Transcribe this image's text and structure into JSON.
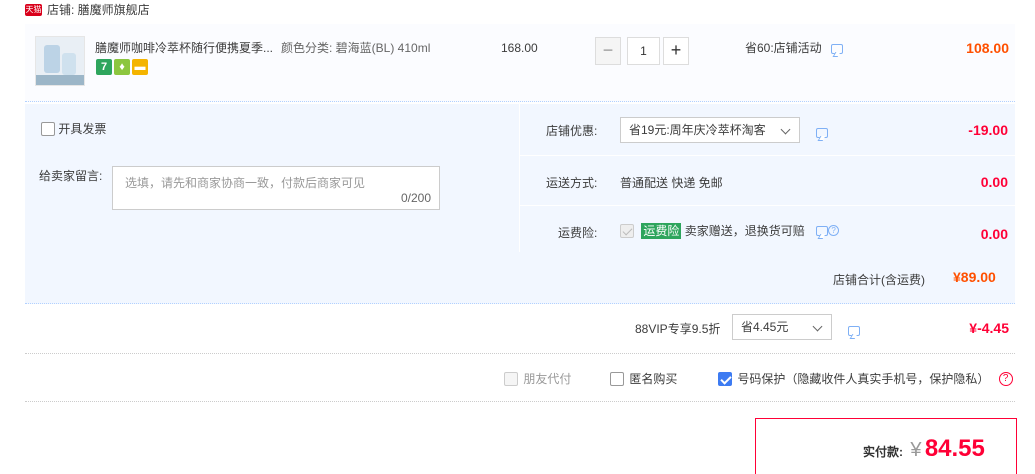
{
  "shop": {
    "badge": "天猫",
    "label": "店铺: 膳魔师旗舰店"
  },
  "item": {
    "title": "膳魔师咖啡冷萃杯随行便携夏季...",
    "sku": "颜色分类: 碧海蓝(BL) 410ml",
    "service_icons": [
      "7",
      "shield-icon",
      "card-icon"
    ],
    "price": "168.00",
    "quantity": "1",
    "minus_label": "−",
    "plus_label": "+",
    "promo": "省60:店铺活动",
    "subtotal": "108.00"
  },
  "options": {
    "invoice_label": "开具发票",
    "message_label": "给卖家留言:",
    "message_placeholder": "选填，请先和商家协商一致，付款后商家可见",
    "message_count": "0/200",
    "shop_discount_label": "店铺优惠:",
    "shop_discount_value": "省19元:周年庆冷萃杯淘客",
    "shop_discount_amount": "-19.00",
    "shipping_label": "运送方式:",
    "shipping_value": "普通配送 快递 免邮",
    "shipping_amount": "0.00",
    "insurance_label": "运费险:",
    "insurance_badge": "运费险",
    "insurance_text": "卖家赠送，退换货可赔",
    "insurance_amount": "0.00",
    "shop_total_label": "店铺合计(含运费)",
    "shop_total_value": "¥89.00"
  },
  "vip": {
    "label": "88VIP专享9.5折",
    "select_value": "省4.45元",
    "amount": "¥-4.45"
  },
  "extras": {
    "friend_pay": "朋友代付",
    "anonymous": "匿名购买",
    "number_protect": "号码保护（隐藏收件人真实手机号，保护隐私）",
    "help": "?"
  },
  "payment": {
    "label": "实付款:",
    "currency": "¥",
    "amount": "84.55"
  },
  "colors": {
    "accent": "#ff0036",
    "orange": "#ff5000",
    "panel": "#f2f7ff"
  }
}
